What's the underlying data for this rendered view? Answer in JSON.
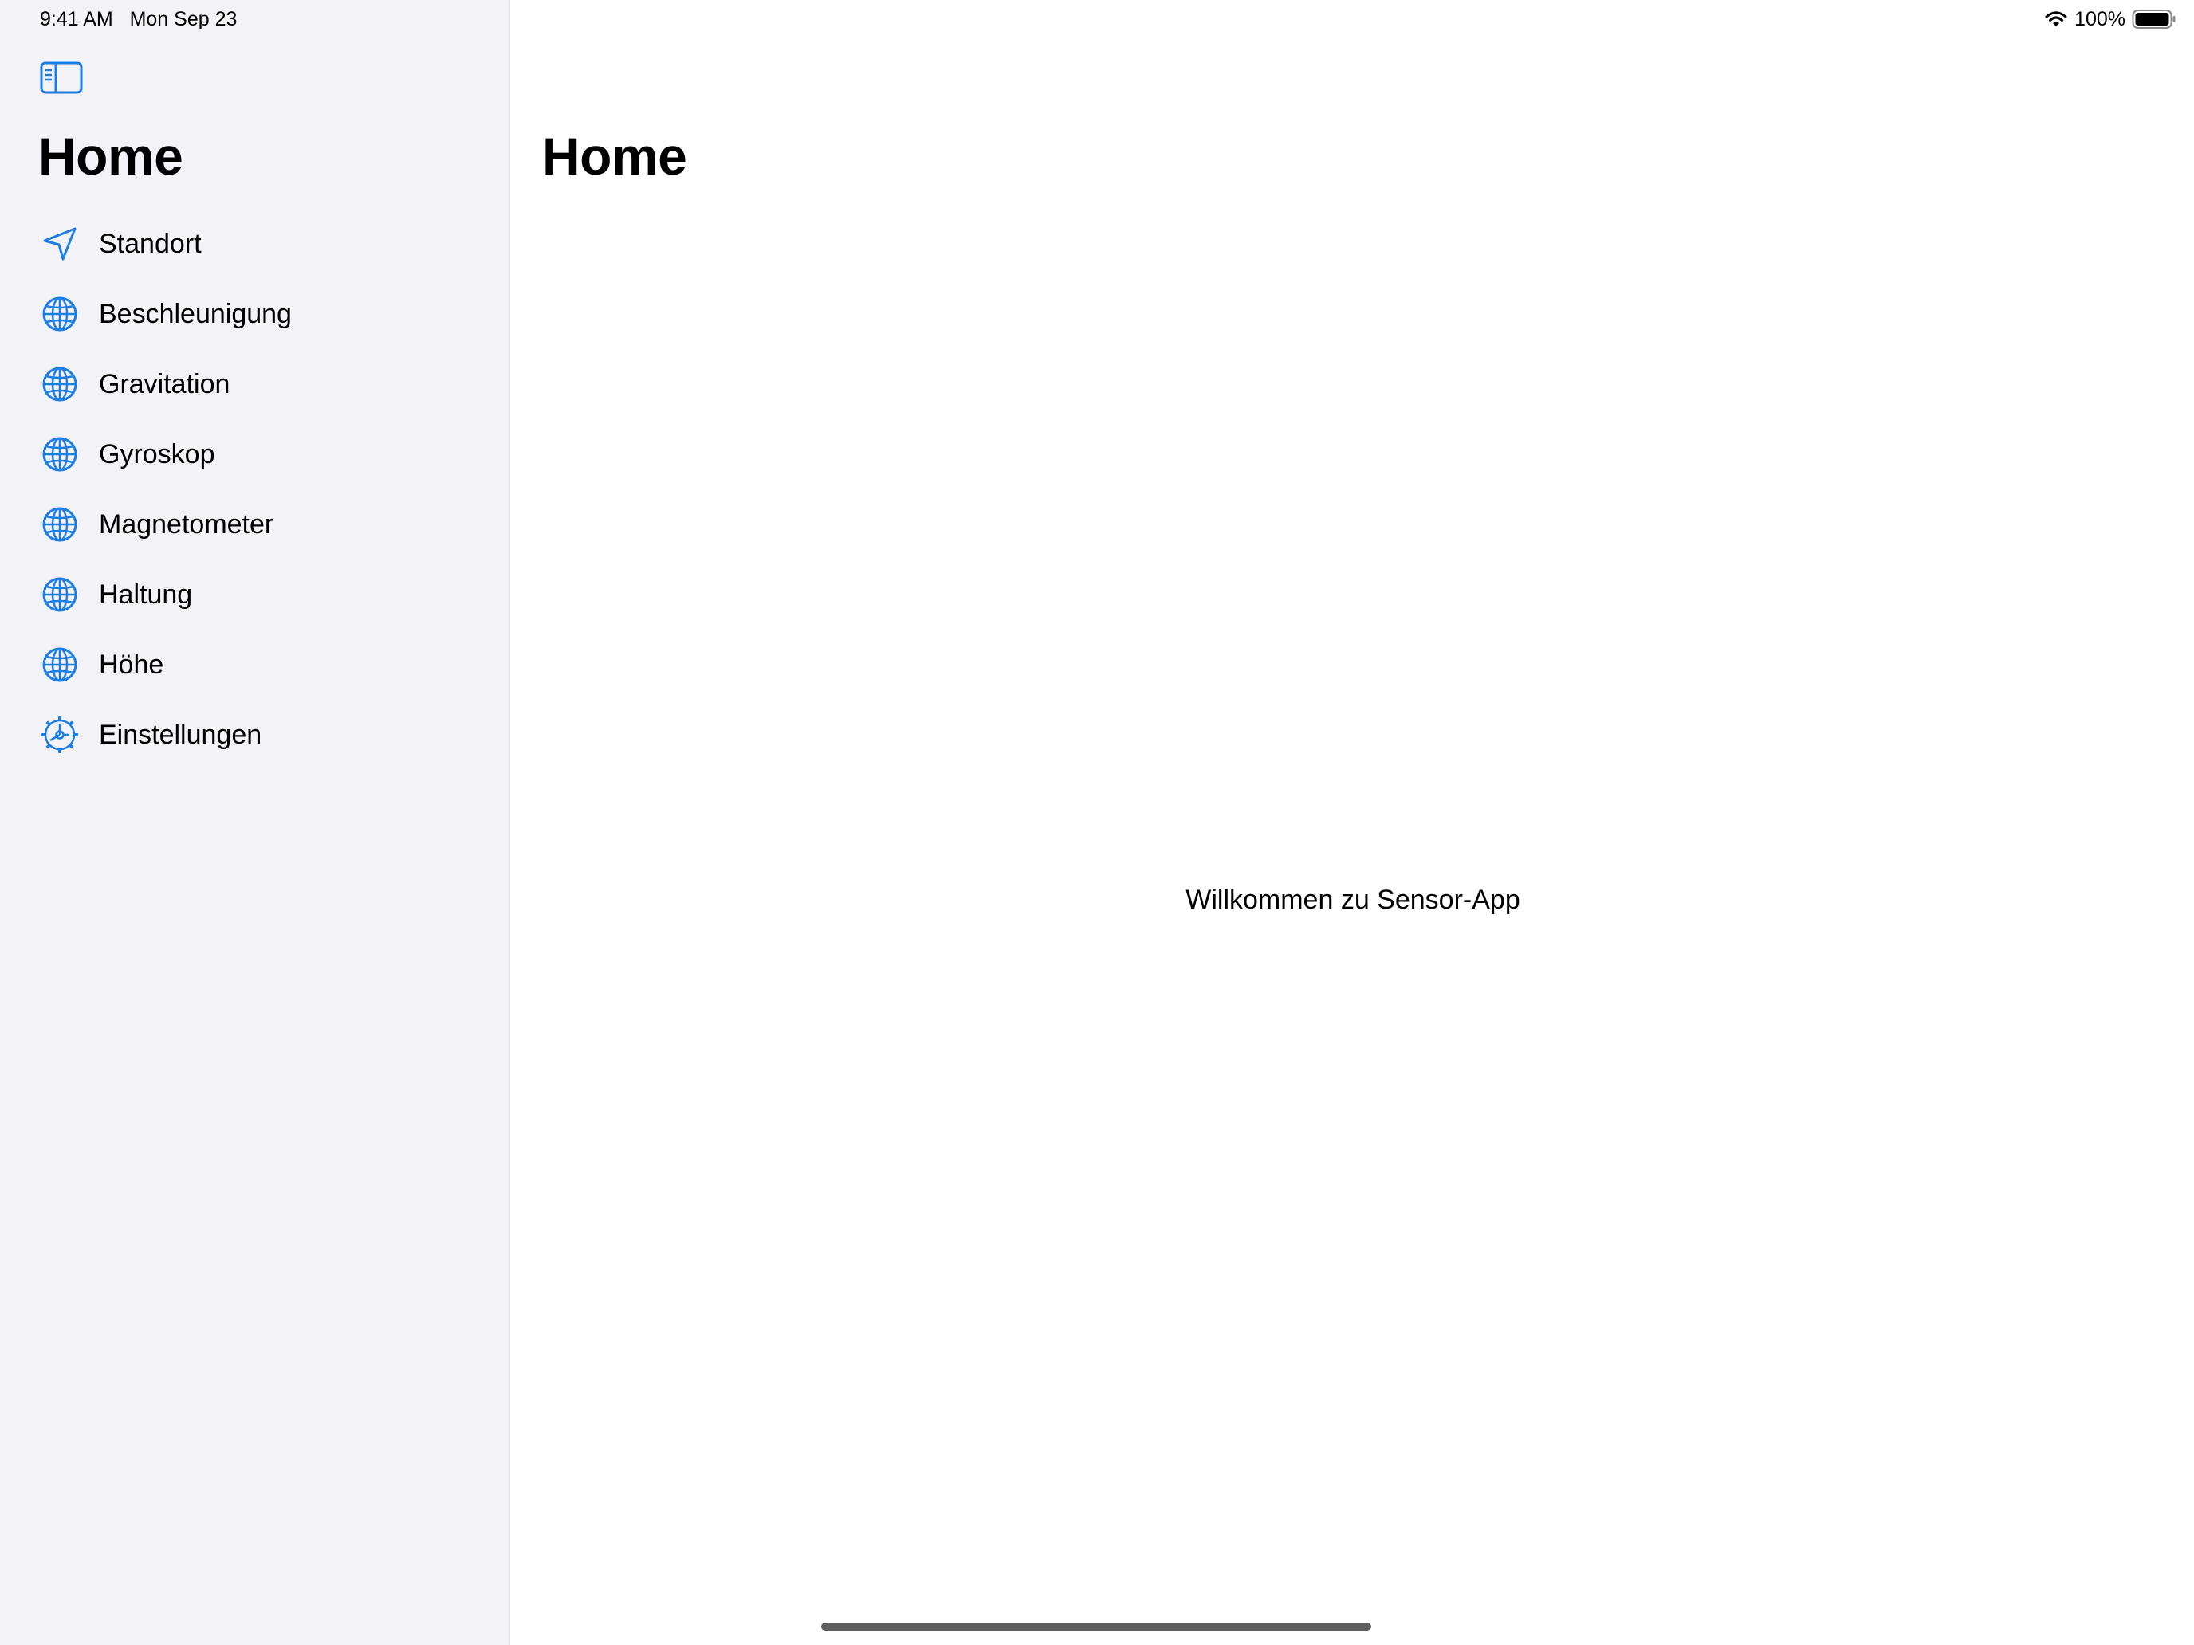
{
  "status_bar": {
    "time": "9:41 AM",
    "date": "Mon Sep 23",
    "battery": "100%",
    "icons": [
      "wifi-icon",
      "battery-icon"
    ]
  },
  "sidebar": {
    "toggle_icon": "sidebar-left-icon",
    "title": "Home",
    "items": [
      {
        "label": "Standort",
        "icon": "location-arrow-icon"
      },
      {
        "label": "Beschleunigung",
        "icon": "globe-icon"
      },
      {
        "label": "Gravitation",
        "icon": "globe-icon"
      },
      {
        "label": "Gyroskop",
        "icon": "globe-icon"
      },
      {
        "label": "Magnetometer",
        "icon": "globe-icon"
      },
      {
        "label": "Haltung",
        "icon": "globe-icon"
      },
      {
        "label": "Höhe",
        "icon": "globe-icon"
      },
      {
        "label": "Einstellungen",
        "icon": "gear-icon"
      }
    ]
  },
  "detail": {
    "title": "Home",
    "welcome_text": "Willkommen zu Sensor-App"
  },
  "colors": {
    "accent": "#1a7ee6",
    "sidebar_bg": "#f2f2f7",
    "detail_bg": "#ffffff",
    "home_indicator": "#5f5f5f"
  }
}
